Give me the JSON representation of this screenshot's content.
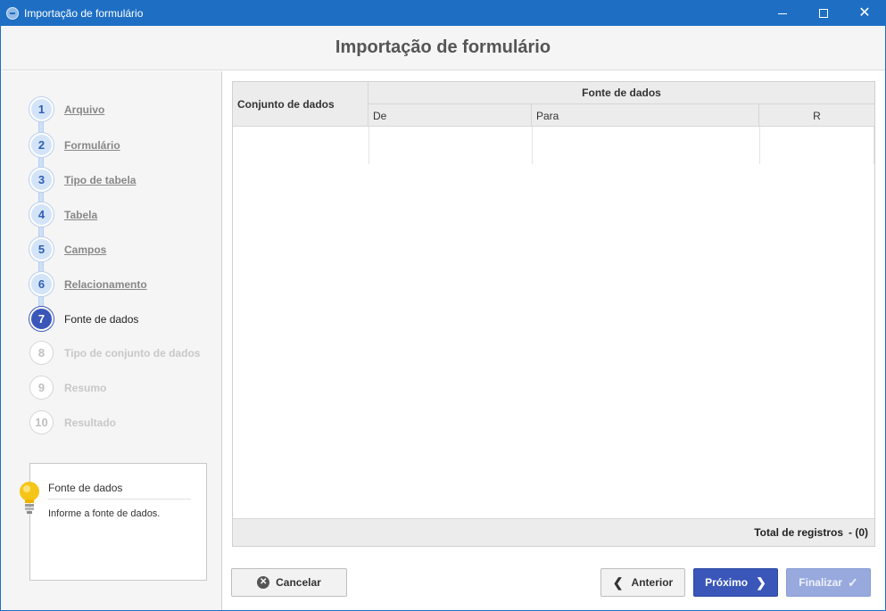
{
  "window": {
    "title": "Importação de formulário"
  },
  "header": {
    "title": "Importação de formulário"
  },
  "steps": [
    {
      "num": "1",
      "label": "Arquivo",
      "state": "done"
    },
    {
      "num": "2",
      "label": "Formulário",
      "state": "done"
    },
    {
      "num": "3",
      "label": "Tipo de tabela",
      "state": "done"
    },
    {
      "num": "4",
      "label": "Tabela",
      "state": "done"
    },
    {
      "num": "5",
      "label": "Campos",
      "state": "done"
    },
    {
      "num": "6",
      "label": "Relacionamento",
      "state": "done"
    },
    {
      "num": "7",
      "label": "Fonte de dados",
      "state": "active"
    },
    {
      "num": "8",
      "label": "Tipo de conjunto de dados",
      "state": "future"
    },
    {
      "num": "9",
      "label": "Resumo",
      "state": "future"
    },
    {
      "num": "10",
      "label": "Resultado",
      "state": "future"
    }
  ],
  "tip": {
    "title": "Fonte de dados",
    "text": "Informe a fonte de dados.",
    "icon": "lightbulb-icon"
  },
  "grid": {
    "col_conjunto": "Conjunto de dados",
    "col_fonte": "Fonte de dados",
    "col_de": "De",
    "col_para": "Para",
    "col_r": "R",
    "footer_label": "Total de registros",
    "footer_count": "- (0)"
  },
  "buttons": {
    "cancel": "Cancelar",
    "previous": "Anterior",
    "next": "Próximo",
    "finish": "Finalizar"
  },
  "colors": {
    "titlebar": "#1e6fc4",
    "accent": "#3956b8",
    "finish_disabled": "#97a9dd"
  }
}
